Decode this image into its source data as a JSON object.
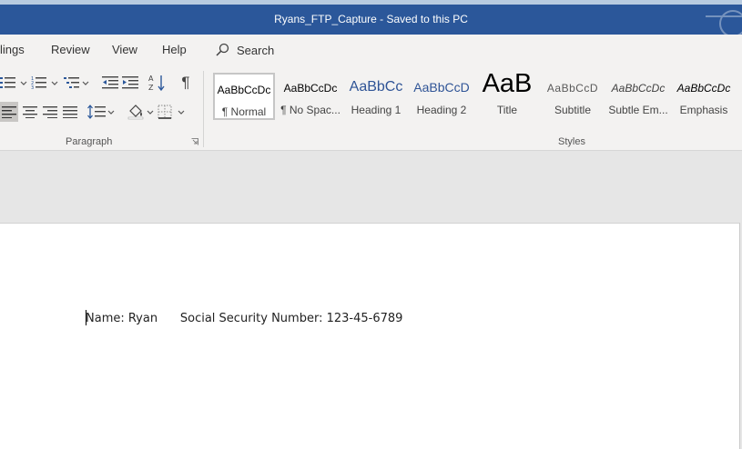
{
  "window": {
    "title": "Ryans_FTP_Capture  -  Saved to this PC"
  },
  "tabs": {
    "mailings_partial": "lings",
    "review": "Review",
    "view": "View",
    "help": "Help",
    "search_label": "Search"
  },
  "ribbon": {
    "paragraph_group_label": "Paragraph",
    "styles_group_label": "Styles",
    "pilcrow": "¶",
    "styles": [
      {
        "preview": "AaBbCcDc",
        "name": "¶ Normal",
        "color": "#000000"
      },
      {
        "preview": "AaBbCcDc",
        "name": "¶ No Spac...",
        "color": "#000000"
      },
      {
        "preview": "AaBbCc",
        "name": "Heading 1",
        "color": "#2f5496"
      },
      {
        "preview": "AaBbCcD",
        "name": "Heading 2",
        "color": "#2f5496"
      },
      {
        "preview": "AaB",
        "name": "Title",
        "color": "#000000"
      },
      {
        "preview": "AaBbCcD",
        "name": "Subtitle",
        "color": "#5a5a5a"
      },
      {
        "preview": "AaBbCcDc",
        "name": "Subtle Em...",
        "color": "#404040"
      },
      {
        "preview": "AaBbCcDc",
        "name": "Emphasis",
        "color": "#000000"
      }
    ]
  },
  "document": {
    "line_text": "Name: Ryan      Social Security Number: 123-45-6789"
  },
  "colors": {
    "title_bar": "#2b579a",
    "ribbon_bg": "#f3f2f1",
    "heading_blue": "#2f5496"
  }
}
